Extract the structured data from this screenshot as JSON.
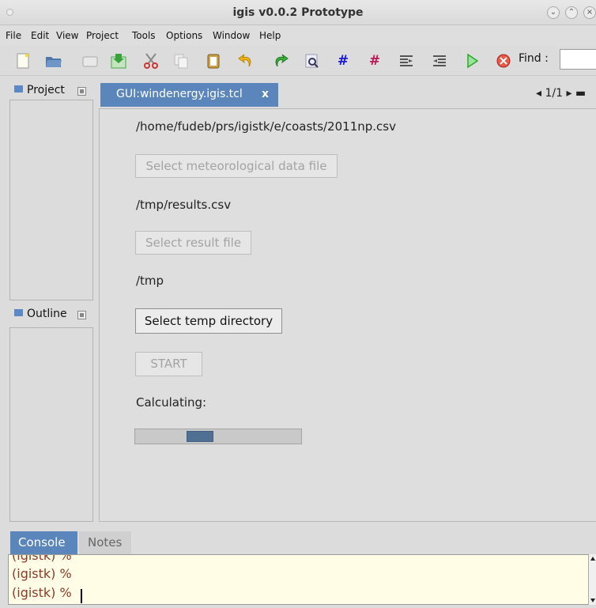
{
  "window": {
    "title": "igis v0.0.2 Prototype"
  },
  "menu": [
    "File",
    "Edit",
    "View",
    "Project",
    "Tools",
    "Options",
    "Window",
    "Help"
  ],
  "toolbar": {
    "icons": [
      "new-file-icon",
      "open-folder-icon",
      "close-icon",
      "save-icon",
      "cut-icon",
      "copy-icon",
      "paste-icon",
      "undo-icon",
      "redo-icon",
      "find-icon",
      "comment-icon",
      "uncomment-icon",
      "indent-icon",
      "unindent-icon",
      "run-icon",
      "stop-icon"
    ],
    "find_label": "Find :",
    "colors": {
      "hash1": "#1a1ad8",
      "hash2": "#c01a54",
      "run": "#2aa82a",
      "stop": "#d23a2a"
    }
  },
  "panels": {
    "project": "Project",
    "outline": "Outline"
  },
  "tab": {
    "label": "GUI:windenergy.igis.tcl",
    "close": "x",
    "nav": "◂ 1/1 ▸ ▬"
  },
  "form": {
    "met_path": "/home/fudeb/prs/igistk/e/coasts/2011np.csv",
    "met_button": "Select meteorological data file",
    "result_path": "/tmp/results.csv",
    "result_button": "Select result file",
    "temp_path": "/tmp",
    "temp_button": "Select temp directory",
    "start_button": "START",
    "calculating_label": "Calculating:",
    "progress": {
      "fill_start_fraction": 0.31,
      "fill_width_fraction": 0.16
    }
  },
  "bottom_tabs": {
    "console": "Console",
    "notes": "Notes"
  },
  "console": {
    "lines": [
      "(igistk) %",
      "(igistk) %",
      "(igistk) %"
    ]
  }
}
